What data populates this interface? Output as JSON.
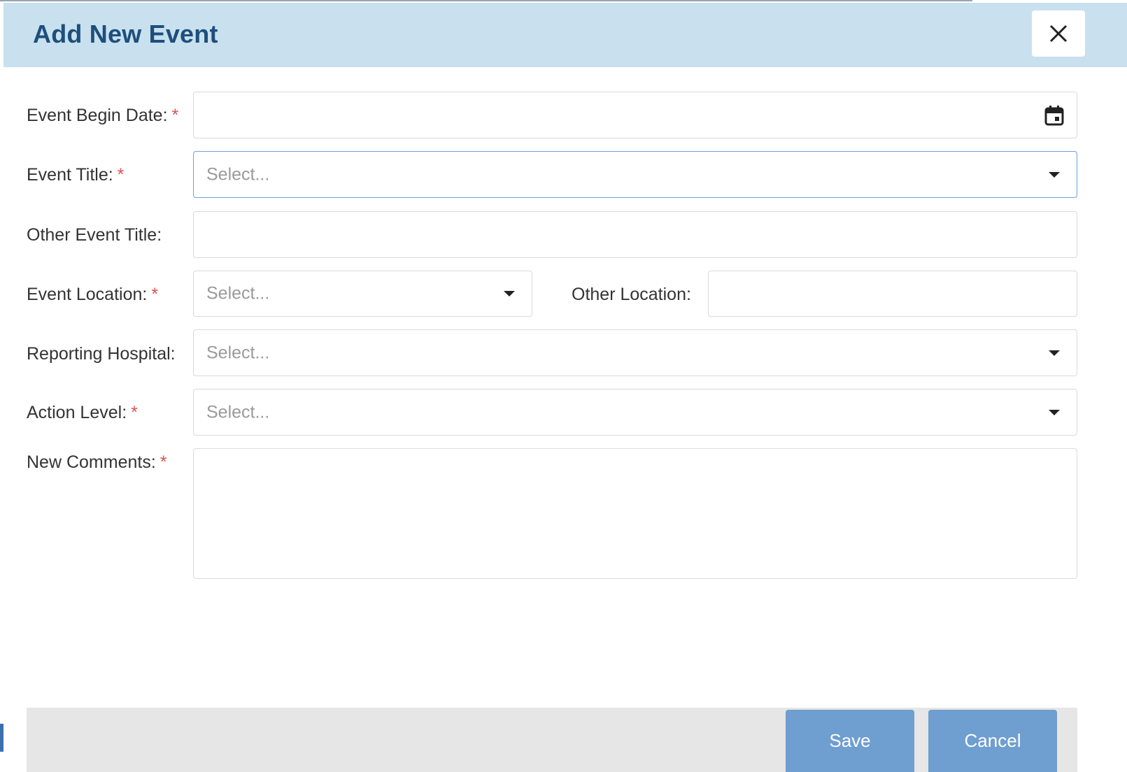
{
  "dialog": {
    "title": "Add New Event",
    "close_icon": "close-icon"
  },
  "form": {
    "begin_date": {
      "label": "Event Begin Date:",
      "required": "*",
      "value": "",
      "icon": "calendar-icon"
    },
    "event_title": {
      "label": "Event Title:",
      "required": "*",
      "placeholder": "Select...",
      "icon": "chevron-down-icon"
    },
    "other_event_title": {
      "label": "Other Event Title:",
      "value": ""
    },
    "event_location": {
      "label": "Event Location:",
      "required": "*",
      "placeholder": "Select...",
      "icon": "chevron-down-icon"
    },
    "other_location": {
      "label": "Other Location:",
      "value": ""
    },
    "reporting_hospital": {
      "label": "Reporting Hospital:",
      "placeholder": "Select...",
      "icon": "chevron-down-icon"
    },
    "action_level": {
      "label": "Action Level:",
      "required": "*",
      "placeholder": "Select...",
      "icon": "chevron-down-icon"
    },
    "new_comments": {
      "label": "New Comments:",
      "required": "*",
      "value": ""
    }
  },
  "footer": {
    "save_label": "Save",
    "cancel_label": "Cancel"
  },
  "colors": {
    "header_bg": "#c9e0ee",
    "title": "#1d4f7c",
    "required": "#d9534f",
    "button": "#6f9ed0",
    "footer_bg": "#e6e6e6"
  }
}
